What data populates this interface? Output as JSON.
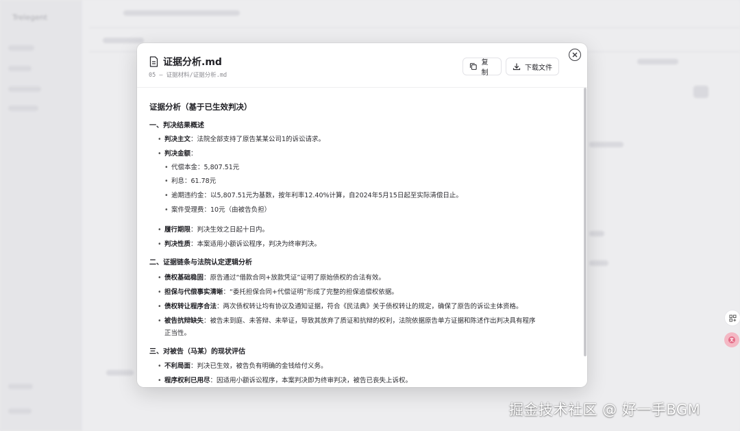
{
  "modal": {
    "title": "证据分析.md",
    "path": "05 – 证据材料/证据分析.md",
    "copy_label": "复制",
    "download_label": "下载文件"
  },
  "doc": {
    "title": "证据分析（基于已生效判决）",
    "s1": {
      "heading": "一、判决结果概述",
      "main_k": "判决主文",
      "main_v": "：法院全部支持了原告某某公司1的诉讼请求。",
      "amount_k": "判决金额",
      "amount_v": "：",
      "sub1": "代偿本金：5,807.51元",
      "sub2": "利息：61.78元",
      "sub3": "逾期违约金：以5,807.51元为基数，按年利率12.40%计算，自2024年5月15日起至实际清偿日止。",
      "sub4": "案件受理费：10元（由被告负担）",
      "period_k": "履行期限",
      "period_v": "：判决生效之日起十日内。",
      "nature_k": "判决性质",
      "nature_v": "：本案适用小额诉讼程序，判决为终审判决。"
    },
    "s2": {
      "heading": "二、证据链条与法院认定逻辑分析",
      "a_k": "债权基础稳固",
      "a_v": "：原告通过“借款合同+放款凭证”证明了原始债权的合法有效。",
      "b_k": "担保与代偿事实清晰",
      "b_v": "：“委托担保合同+代偿证明”形成了完整的担保追偿权依据。",
      "c_k": "债权转让程序合法",
      "c_v": "：两次债权转让均有协议及通知证据，符合《民法典》关于债权转让的规定，确保了原告的诉讼主体资格。",
      "d_k": "被告抗辩缺失",
      "d_v": "：被告未到庭、未答辩、未举证，导致其放弃了质证和抗辩的权利，法院依据原告单方证据和陈述作出判决具有程序",
      "d_v2": "正当性。"
    },
    "s3": {
      "heading": "三、对被告（马某）的现状评估",
      "a_k": "不利局面",
      "a_v": "：判决已生效，被告负有明确的金钱给付义务。",
      "b_k": "程序权利已用尽",
      "b_v": "：因适用小额诉讼程序，本案判决即为终审判决，被告已丧失上诉权。"
    }
  },
  "watermark": "掘金技术社区 @ 好一手BGM",
  "background": {
    "app_name": "Trelegent"
  }
}
